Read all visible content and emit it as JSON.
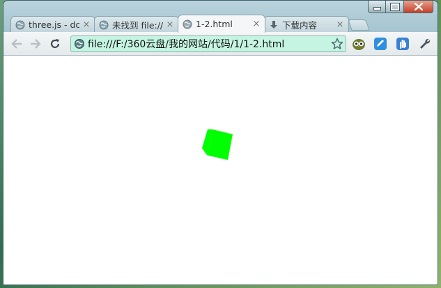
{
  "window": {
    "caption": {
      "minimize": "minimize",
      "maximize": "maximize",
      "close": "close"
    }
  },
  "tabs": [
    {
      "label": "three.js - dc",
      "close": "×",
      "icon": "globe-icon",
      "active": false
    },
    {
      "label": "未找到 file://",
      "close": "×",
      "icon": "globe-icon",
      "active": false
    },
    {
      "label": "1-2.html",
      "close": "×",
      "icon": "globe-icon",
      "active": true
    },
    {
      "label": "下载内容",
      "close": "×",
      "icon": "download-icon",
      "active": false
    }
  ],
  "toolbar": {
    "back": "back-arrow-icon",
    "forward": "forward-arrow-icon",
    "reload": "reload-icon",
    "address": "file:///F:/360云盘/我的网站/代码/1/1-2.html",
    "bookmark": "star-icon",
    "extensions": [
      "owl-extension-icon",
      "blue-edit-extension-icon",
      "blue-hand-extension-icon",
      "wrench-icon"
    ]
  },
  "page": {
    "object": "green-cube",
    "colors": {
      "cube": "#00ff00",
      "background": "#ffffff"
    }
  }
}
